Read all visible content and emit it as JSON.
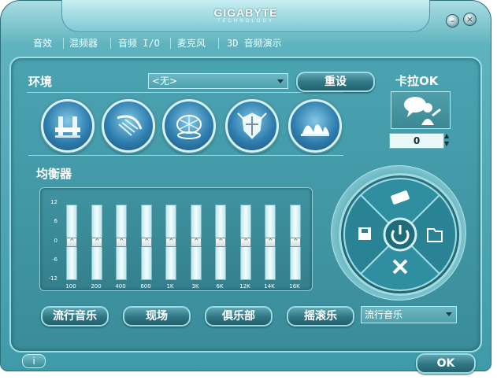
{
  "brand": {
    "name": "GIGABYTE",
    "sub": "TECHNOLOGY"
  },
  "tabs": [
    {
      "label": "音效"
    },
    {
      "label": "混频器"
    },
    {
      "label": "音频 I/O"
    },
    {
      "label": "麦克风"
    },
    {
      "label": "3D 音频演示"
    }
  ],
  "environment": {
    "title": "环境",
    "select_value": "<无>",
    "reset_label": "重设",
    "icons": [
      "bathroom-icon",
      "shower-icon",
      "stadium-icon",
      "knight-icon",
      "opera-house-icon"
    ]
  },
  "karaoke": {
    "title": "卡拉OK",
    "value": "0"
  },
  "equalizer": {
    "title": "均衡器",
    "scale_labels": [
      "12",
      "6",
      "0",
      "-6",
      "-12"
    ],
    "bands": [
      {
        "freq": "100",
        "value": 0
      },
      {
        "freq": "200",
        "value": 0
      },
      {
        "freq": "400",
        "value": 0
      },
      {
        "freq": "600",
        "value": 0
      },
      {
        "freq": "1K",
        "value": 0
      },
      {
        "freq": "3K",
        "value": 0
      },
      {
        "freq": "6K",
        "value": 0
      },
      {
        "freq": "12K",
        "value": 0
      },
      {
        "freq": "14K",
        "value": 0
      },
      {
        "freq": "16K",
        "value": 0
      }
    ],
    "presets": [
      "流行音乐",
      "现场",
      "俱乐部",
      "摇滚乐"
    ],
    "preset_select_value": "流行音乐"
  },
  "footer": {
    "ok_label": "OK",
    "info_label": "i"
  },
  "colors": {
    "accent": "#3f9aa8",
    "panel": "#4aa3b1",
    "highlight": "#9fdce4"
  }
}
